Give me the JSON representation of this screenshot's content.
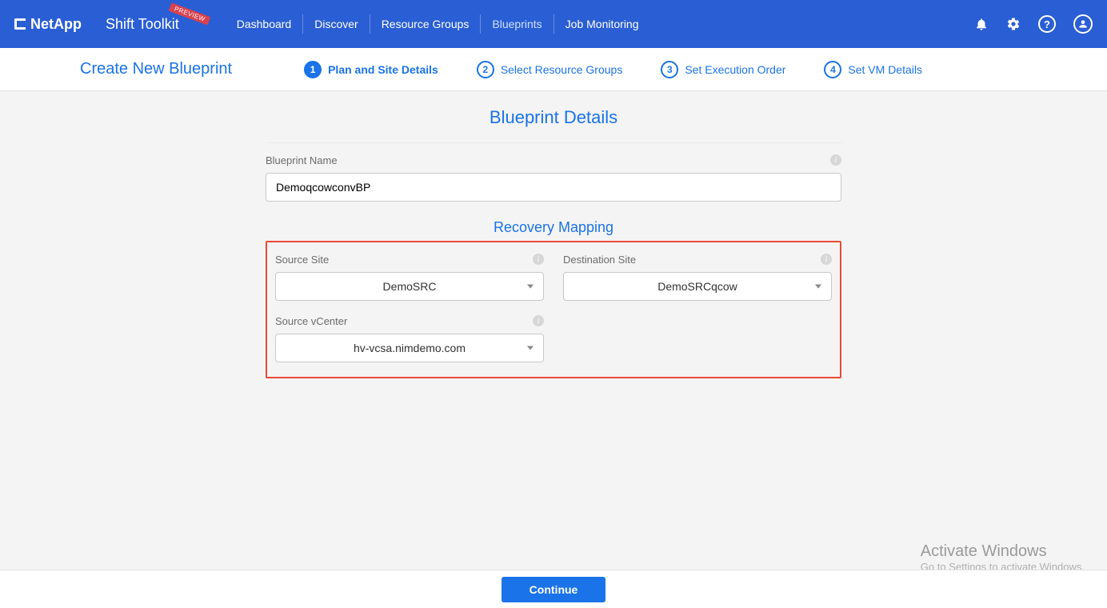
{
  "brand": "NetApp",
  "product": "Shift Toolkit",
  "preview_badge": "PREVIEW",
  "nav": {
    "dashboard": "Dashboard",
    "discover": "Discover",
    "resource_groups": "Resource Groups",
    "blueprints": "Blueprints",
    "job_monitoring": "Job Monitoring"
  },
  "stepbar": {
    "title": "Create New Blueprint",
    "step1": "Plan and Site Details",
    "step2": "Select Resource Groups",
    "step3": "Set Execution Order",
    "step4": "Set VM Details"
  },
  "section": {
    "blueprint_details": "Blueprint Details",
    "recovery_mapping": "Recovery Mapping"
  },
  "form": {
    "blueprint_name_label": "Blueprint Name",
    "blueprint_name_value": "DemoqcowconvBP",
    "source_site_label": "Source Site",
    "source_site_value": "DemoSRC",
    "destination_site_label": "Destination Site",
    "destination_site_value": "DemoSRCqcow",
    "source_vcenter_label": "Source vCenter",
    "source_vcenter_value": "hv-vcsa.nimdemo.com"
  },
  "footer": {
    "continue": "Continue"
  },
  "watermark": {
    "line1": "Activate Windows",
    "line2": "Go to Settings to activate Windows."
  }
}
